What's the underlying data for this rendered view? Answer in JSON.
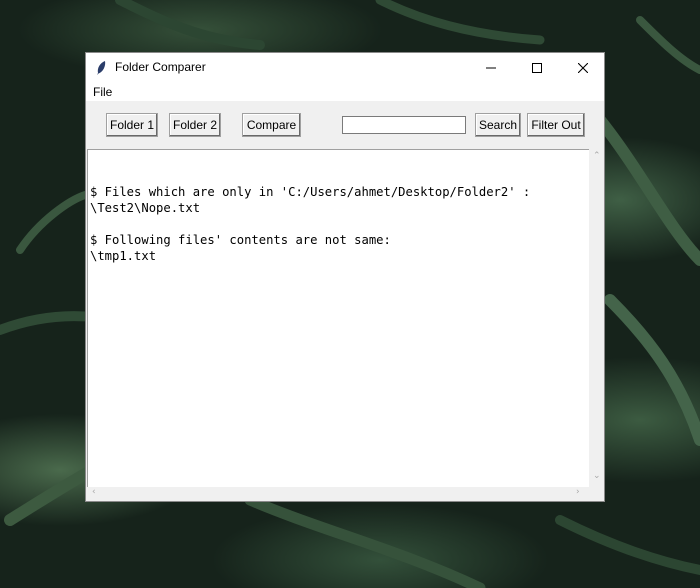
{
  "window": {
    "title": "Folder Comparer",
    "controls": [
      "minimize-icon",
      "maximize-icon",
      "close-icon"
    ]
  },
  "menu": {
    "file": "File"
  },
  "toolbar": {
    "folder1": "Folder 1",
    "folder2": "Folder 2",
    "compare": "Compare",
    "search_value": "",
    "search": "Search",
    "filter_out": "Filter Out"
  },
  "output": {
    "lines": [
      "",
      "$ Files which are only in 'C:/Users/ahmet/Desktop/Folder2' :",
      "\\Test2\\Nope.txt",
      "",
      "$ Following files' contents are not same:",
      "\\tmp1.txt"
    ]
  }
}
